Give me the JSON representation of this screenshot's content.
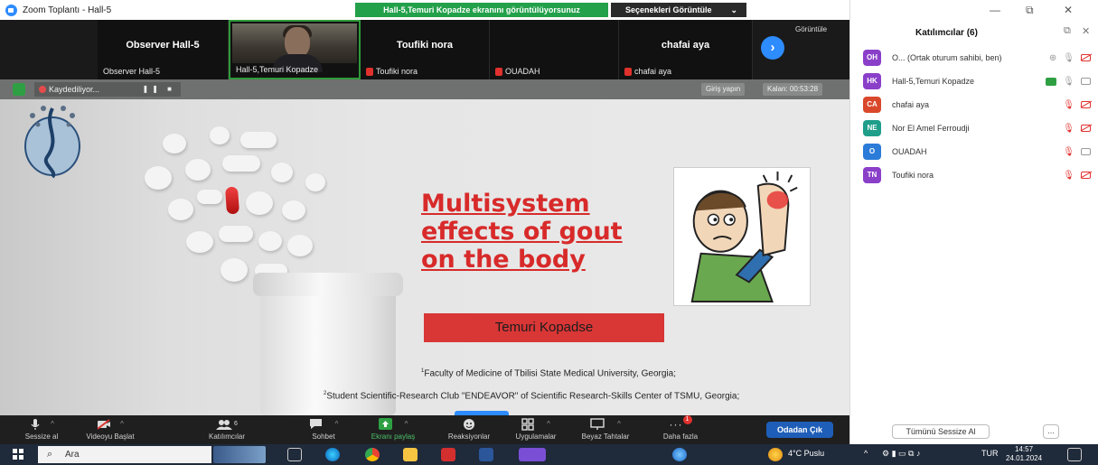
{
  "titlebar": {
    "title": "Zoom Toplantı - Hall-5"
  },
  "share_banner": "Hall-5,Temuri Kopadze ekranını görüntülüyorsunuz",
  "view_options": {
    "label": "Seçenekleri Görüntüle",
    "chevron": "⌄"
  },
  "strip": {
    "view_label": "Görüntüle",
    "next_arrow": "›",
    "tiles": [
      {
        "big": "Observer Hall-5",
        "small": "Observer Hall-5",
        "muted": false
      },
      {
        "big": "",
        "small": "Hall-5,Temuri Kopadze",
        "muted": false
      },
      {
        "big": "Toufiki nora",
        "small": "Toufiki nora",
        "muted": true
      },
      {
        "big": "",
        "small": "OUADAH",
        "muted": true
      },
      {
        "big": "chafai aya",
        "small": "chafai aya",
        "muted": true
      }
    ]
  },
  "recording": {
    "label": "Kaydediliyor...",
    "controls": "❚❚ ■"
  },
  "top_right_buttons": {
    "signin": "Giriş yapın",
    "remaining": "Kalan: 00:53:28"
  },
  "slide": {
    "title_lines": [
      "Multisystem",
      "effects of gout",
      "on the body"
    ],
    "author": "Temuri Kopadse",
    "affiliation_1": "Faculty of Medicine of Tbilisi State Medical University, Georgia;",
    "affiliation_2": "Student Scientific-Research Club \"ENDEAVOR\" of Scientific Research-Skills Center of TSMU, Georgia;",
    "sup_1": "1",
    "sup_2": "2"
  },
  "toolbar": {
    "items": [
      {
        "label": "Sessize al",
        "icon": "microphone-icon"
      },
      {
        "label": "Videoyu Başlat",
        "icon": "video-off-icon"
      },
      {
        "label": "Katılımcılar",
        "icon": "participants-icon",
        "count": "6"
      },
      {
        "label": "Sohbet",
        "icon": "chat-icon"
      },
      {
        "label": "Ekranı paylaş",
        "icon": "share-screen-icon"
      },
      {
        "label": "Reaksiyonlar",
        "icon": "reactions-icon"
      },
      {
        "label": "Uygulamalar",
        "icon": "apps-icon"
      },
      {
        "label": "Beyaz Tahtalar",
        "icon": "whiteboard-icon"
      },
      {
        "label": "Daha fazla",
        "icon": "more-icon",
        "badge": "1"
      }
    ],
    "leave": "Odadan Çık"
  },
  "panel": {
    "title": "Katılımcılar (6)",
    "participants": [
      {
        "initials": "OH",
        "color": "#8a3fc9",
        "name": "O... (Ortak oturum sahibi, ben)",
        "audio": "grey",
        "video": "off"
      },
      {
        "initials": "HK",
        "color": "#8a3fc9",
        "name": "Hall-5,Temuri Kopadze",
        "audio": "grey",
        "video": "grey",
        "sharing": true
      },
      {
        "initials": "CA",
        "color": "#d9482b",
        "name": "chafai aya",
        "audio": "off",
        "video": "off"
      },
      {
        "initials": "NE",
        "color": "#1f9e8a",
        "name": "Nor El Amel Ferroudji",
        "audio": "off",
        "video": "off"
      },
      {
        "initials": "O",
        "color": "#2b7bd9",
        "name": "OUADAH",
        "audio": "off",
        "video": "grey"
      },
      {
        "initials": "TN",
        "color": "#8a3fc9",
        "name": "Toufiki nora",
        "audio": "off",
        "video": "off"
      }
    ],
    "mute_all": "Tümünü Sessize Al",
    "more": "..."
  },
  "taskbar": {
    "search": "Ara",
    "weather": "4°C Puslu",
    "lang": "TUR",
    "time": "14:57",
    "date": "24.01.2024"
  },
  "colors": {
    "zoom_blue": "#2d8cff",
    "title_red": "#d82a2a",
    "author_box": "#d93636",
    "share_green": "#23a04a"
  }
}
